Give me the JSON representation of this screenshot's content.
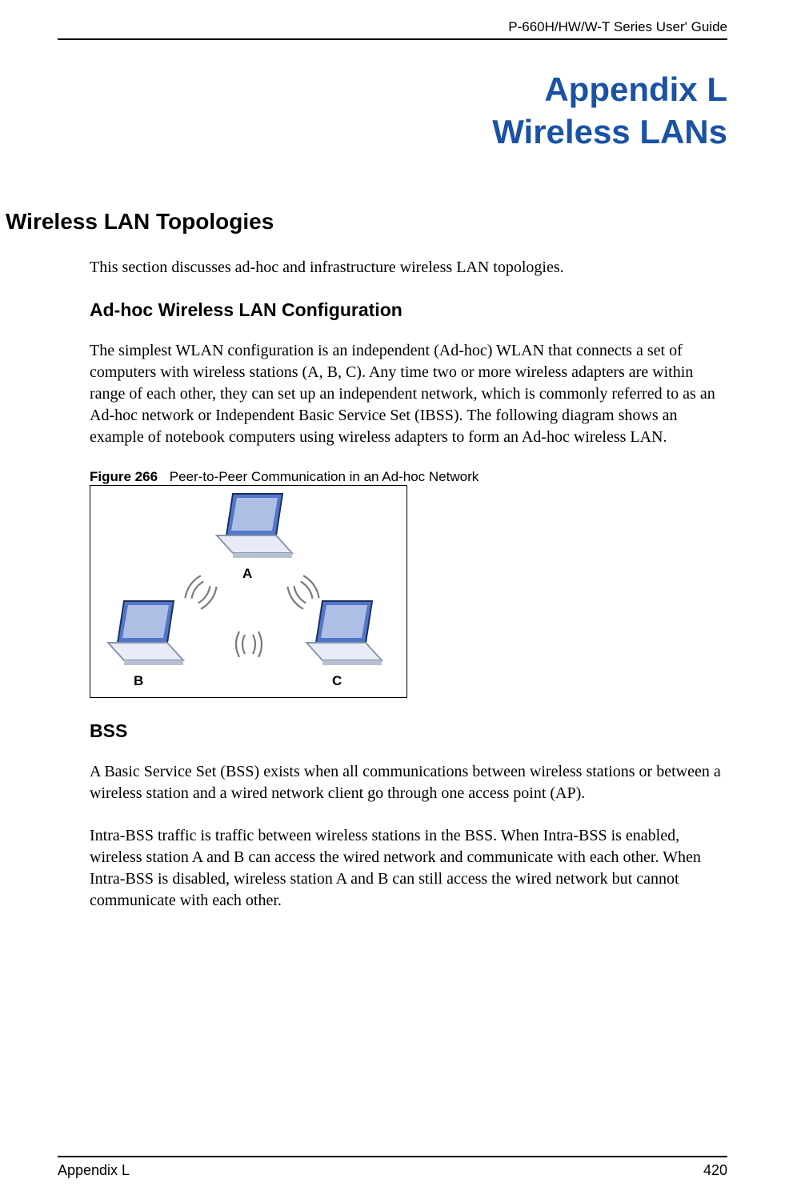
{
  "header": {
    "guide": "P-660H/HW/W-T Series User' Guide"
  },
  "title": {
    "line1": "Appendix L",
    "line2": "Wireless LANs"
  },
  "section": {
    "h1": "Wireless LAN Topologies",
    "intro": "This section discusses ad-hoc and infrastructure wireless LAN topologies.",
    "adhoc": {
      "heading": "Ad-hoc Wireless LAN Configuration",
      "body": "The simplest WLAN configuration is an independent (Ad-hoc) WLAN that connects a set of computers with wireless stations (A, B, C). Any time two or more wireless adapters are within range of each other, they can set up an independent network, which is commonly referred to as an Ad-hoc network or Independent Basic Service Set (IBSS). The following diagram shows an example of notebook computers using wireless adapters to form an Ad-hoc wireless LAN."
    },
    "figure": {
      "label": "Figure 266",
      "caption": "Peer-to-Peer Communication in an Ad-hoc Network",
      "nodes": {
        "a": "A",
        "b": "B",
        "c": "C"
      }
    },
    "bss": {
      "heading": "BSS",
      "p1": "A Basic Service Set (BSS) exists when all communications between wireless stations or between a wireless station and a wired network client go through one access point (AP).",
      "p2": "Intra-BSS traffic is traffic between wireless stations in the BSS. When Intra-BSS is enabled, wireless station A and B can access the wired network and communicate with each other. When Intra-BSS is disabled, wireless station A and B can still access the wired network but cannot communicate with each other."
    }
  },
  "footer": {
    "left": "Appendix L",
    "right": "420"
  }
}
